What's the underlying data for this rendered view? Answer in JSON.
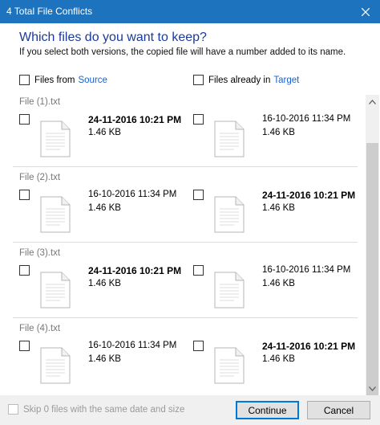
{
  "window": {
    "title": "4 Total File Conflicts"
  },
  "dialog": {
    "heading": "Which files do you want to keep?",
    "subheading": "If you select both versions, the copied file will have a number added to its name."
  },
  "filters": {
    "source": {
      "label": "Files from",
      "link": "Source"
    },
    "target": {
      "label": "Files already in",
      "link": "Target"
    }
  },
  "conflicts": [
    {
      "name": "File (1).txt",
      "source": {
        "date": "24-11-2016 10:21 PM",
        "size": "1.46 KB"
      },
      "target": {
        "date": "16-10-2016 11:34 PM",
        "size": "1.46 KB"
      }
    },
    {
      "name": "File (2).txt",
      "source": {
        "date": "16-10-2016 11:34 PM",
        "size": "1.46 KB"
      },
      "target": {
        "date": "24-11-2016 10:21 PM",
        "size": "1.46 KB"
      }
    },
    {
      "name": "File (3).txt",
      "source": {
        "date": "24-11-2016 10:21 PM",
        "size": "1.46 KB"
      },
      "target": {
        "date": "16-10-2016 11:34 PM",
        "size": "1.46 KB"
      }
    },
    {
      "name": "File (4).txt",
      "source": {
        "date": "16-10-2016 11:34 PM",
        "size": "1.46 KB"
      },
      "target": {
        "date": "24-11-2016 10:21 PM",
        "size": "1.46 KB"
      }
    }
  ],
  "footer": {
    "skip_label": "Skip 0 files with the same date and size",
    "continue_label": "Continue",
    "cancel_label": "Cancel"
  },
  "colors": {
    "titlebar": "#1e73be",
    "heading": "#1a3a9e",
    "link": "#1b62c8",
    "primary_border": "#0078d7"
  },
  "icons": [
    "close-icon",
    "file-icon",
    "scroll-up-arrow-icon",
    "scroll-down-arrow-icon"
  ]
}
